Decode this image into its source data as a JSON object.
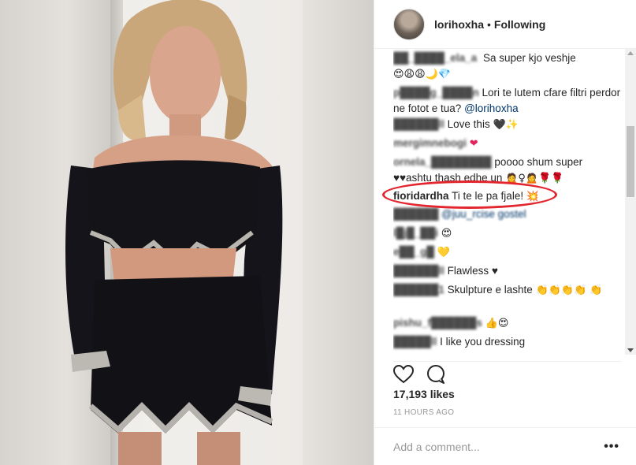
{
  "post": {
    "username": "lorihoxha",
    "separator": "•",
    "follow_status": "Following",
    "likes": "17,193 likes",
    "timestamp": "11 HOURS AGO"
  },
  "comments": [
    {
      "user": "██_████_ela_a",
      "text": "Sa super kjo veshje",
      "emoji": "😍😩😩🌙💎"
    },
    {
      "user": "p████g_████n",
      "text": "Lori te lutem cfare filtri perdor ne fotot e tua?",
      "mention": "@lorihoxha"
    },
    {
      "user": "██████ll",
      "text": "Love this",
      "emoji": "🖤✨"
    },
    {
      "user": "mergimnebogi",
      "text": "",
      "emoji": "❤"
    },
    {
      "user": "ornela_████████",
      "text": "poooo shum super ♥♥ashtu thash edhe un",
      "emoji": "🙍♀🙍🌹🌹"
    },
    {
      "user": "fioridardha",
      "text": "Ti te le pa fjale!",
      "emoji": "💥"
    },
    {
      "user": "██████",
      "text": "",
      "mention": "@juu_rcise gostel"
    },
    {
      "user": "l█j█_██i",
      "text": "",
      "emoji": "😍"
    },
    {
      "user": "e██_g█",
      "text": "",
      "emoji": "💛"
    },
    {
      "user": "██████ll",
      "text": "Flawless ♥"
    },
    {
      "user": "██████1",
      "text": "Skulpture e lashte",
      "emoji": "👏👏👏👏 👏"
    },
    {
      "user": "pishu_f██████s",
      "text": "",
      "emoji": "👍😍"
    },
    {
      "user": "█████ll",
      "text": "I like you dressing"
    }
  ],
  "actions": {
    "like_icon": "heart-icon",
    "comment_icon": "comment-bubble-icon"
  },
  "add_comment": {
    "placeholder": "Add a comment...",
    "more_label": "•••"
  }
}
